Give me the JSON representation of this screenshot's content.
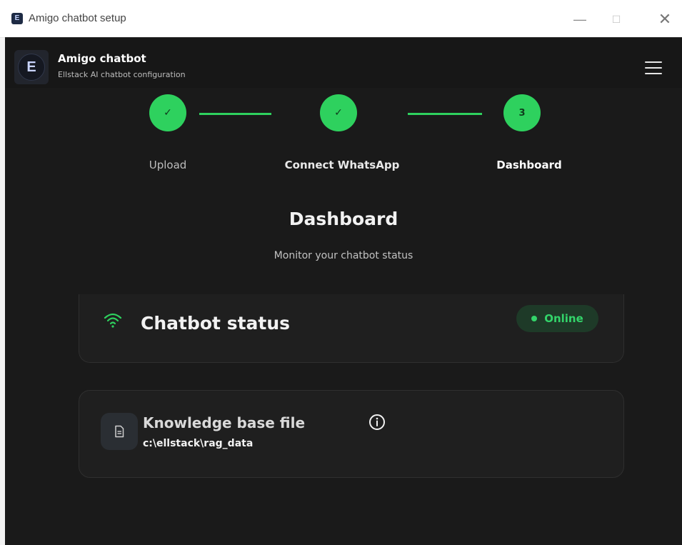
{
  "window": {
    "title": "Amigo chatbot setup",
    "minimize_glyph": "—",
    "maximize_glyph": "☐",
    "close_glyph": "✕"
  },
  "header": {
    "app_name": "Amigo chatbot",
    "subtitle": "Ellstack AI chatbot configuration",
    "logo_letter": "E"
  },
  "stepper": {
    "steps": [
      {
        "label": "Upload",
        "state": "complete",
        "marker": "✓"
      },
      {
        "label": "Connect WhatsApp",
        "state": "complete",
        "marker": "✓"
      },
      {
        "label": "Dashboard",
        "state": "active",
        "marker": "3"
      }
    ]
  },
  "page": {
    "title": "Dashboard",
    "subtitle": "Monitor your chatbot status"
  },
  "status_card": {
    "title": "Chatbot status",
    "badge": "Online",
    "icon": "wifi-icon"
  },
  "kb_card": {
    "title": "Knowledge base file",
    "path": "c:\\ellstack\\rag_data",
    "icon": "file-icon",
    "info_icon": "info-icon"
  },
  "colors": {
    "accent_green": "#2ed15e",
    "background": "#1a1a1a",
    "card": "#1f1f1f"
  }
}
